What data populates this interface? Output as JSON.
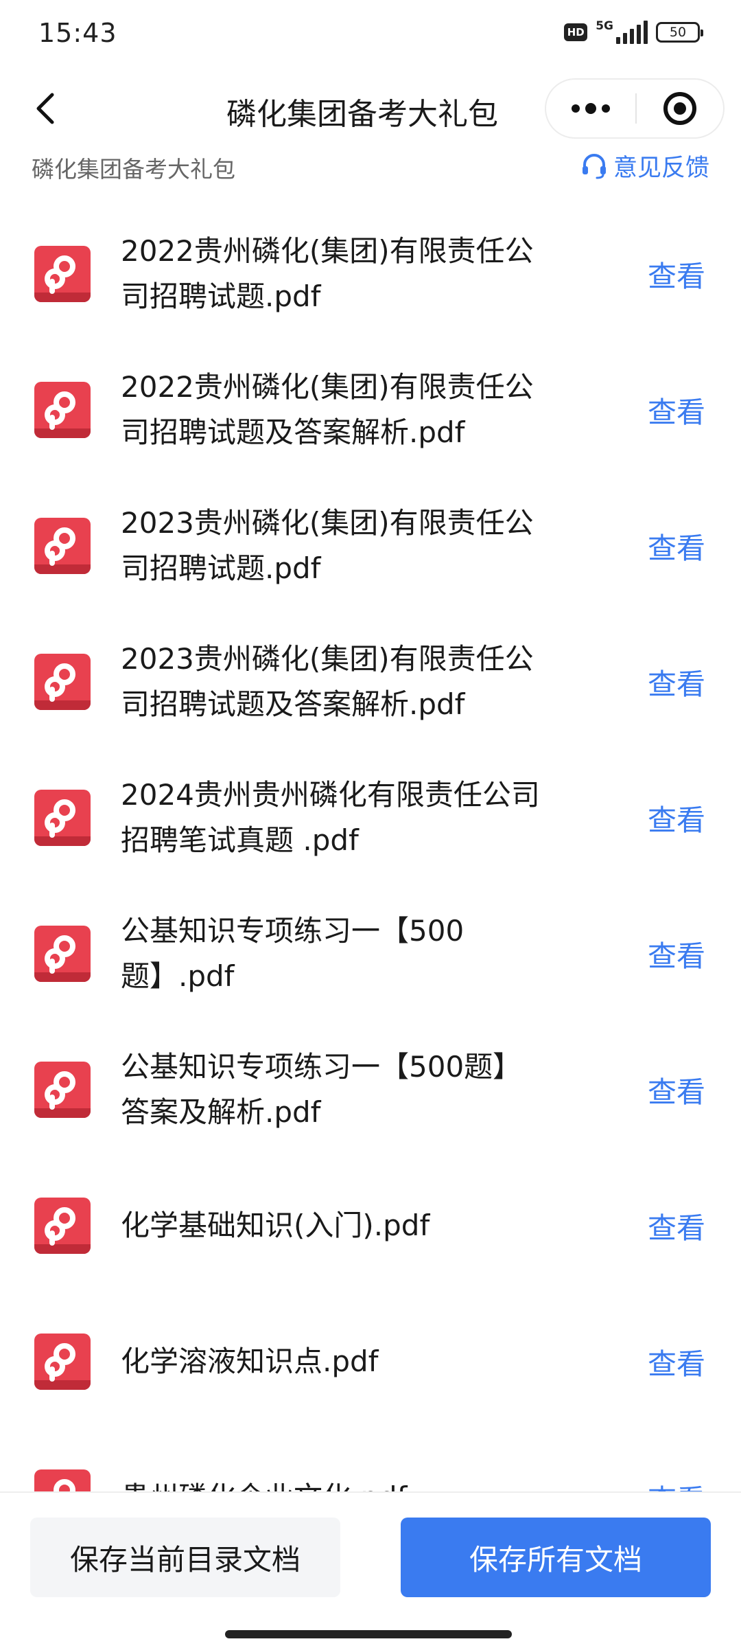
{
  "status_bar": {
    "time": "15:43",
    "hd_label": "HD",
    "network_label": "5G",
    "battery_level": "50"
  },
  "nav": {
    "title": "磷化集团备考大礼包",
    "more_icon": "more-dots-icon",
    "close_icon": "target-close-icon",
    "back_icon": "chevron-left-icon"
  },
  "sub_header": {
    "folder_name": "磷化集团备考大礼包",
    "feedback_label": "意见反馈",
    "feedback_icon": "headset-icon"
  },
  "files": [
    {
      "name": "2022贵州磷化(集团)有限责任公司招聘试题.pdf",
      "action": "查看"
    },
    {
      "name": "2022贵州磷化(集团)有限责任公司招聘试题及答案解析.pdf",
      "action": "查看"
    },
    {
      "name": "2023贵州磷化(集团)有限责任公司招聘试题.pdf",
      "action": "查看"
    },
    {
      "name": "2023贵州磷化(集团)有限责任公司招聘试题及答案解析.pdf",
      "action": "查看"
    },
    {
      "name": "2024贵州贵州磷化有限责任公司招聘笔试真题 .pdf",
      "action": "查看"
    },
    {
      "name": "公基知识专项练习一【500题】.pdf",
      "action": "查看"
    },
    {
      "name": "公基知识专项练习一【500题】答案及解析.pdf",
      "action": "查看"
    },
    {
      "name": "化学基础知识(入门).pdf",
      "action": "查看"
    },
    {
      "name": "化学溶液知识点.pdf",
      "action": "查看"
    },
    {
      "name": "贵州磷化企业文化.pdf",
      "action": "查看"
    }
  ],
  "bottom": {
    "save_current_label": "保存当前目录文档",
    "save_all_label": "保存所有文档"
  },
  "colors": {
    "accent": "#3a7bf0",
    "pdf_red": "#e8414f"
  }
}
